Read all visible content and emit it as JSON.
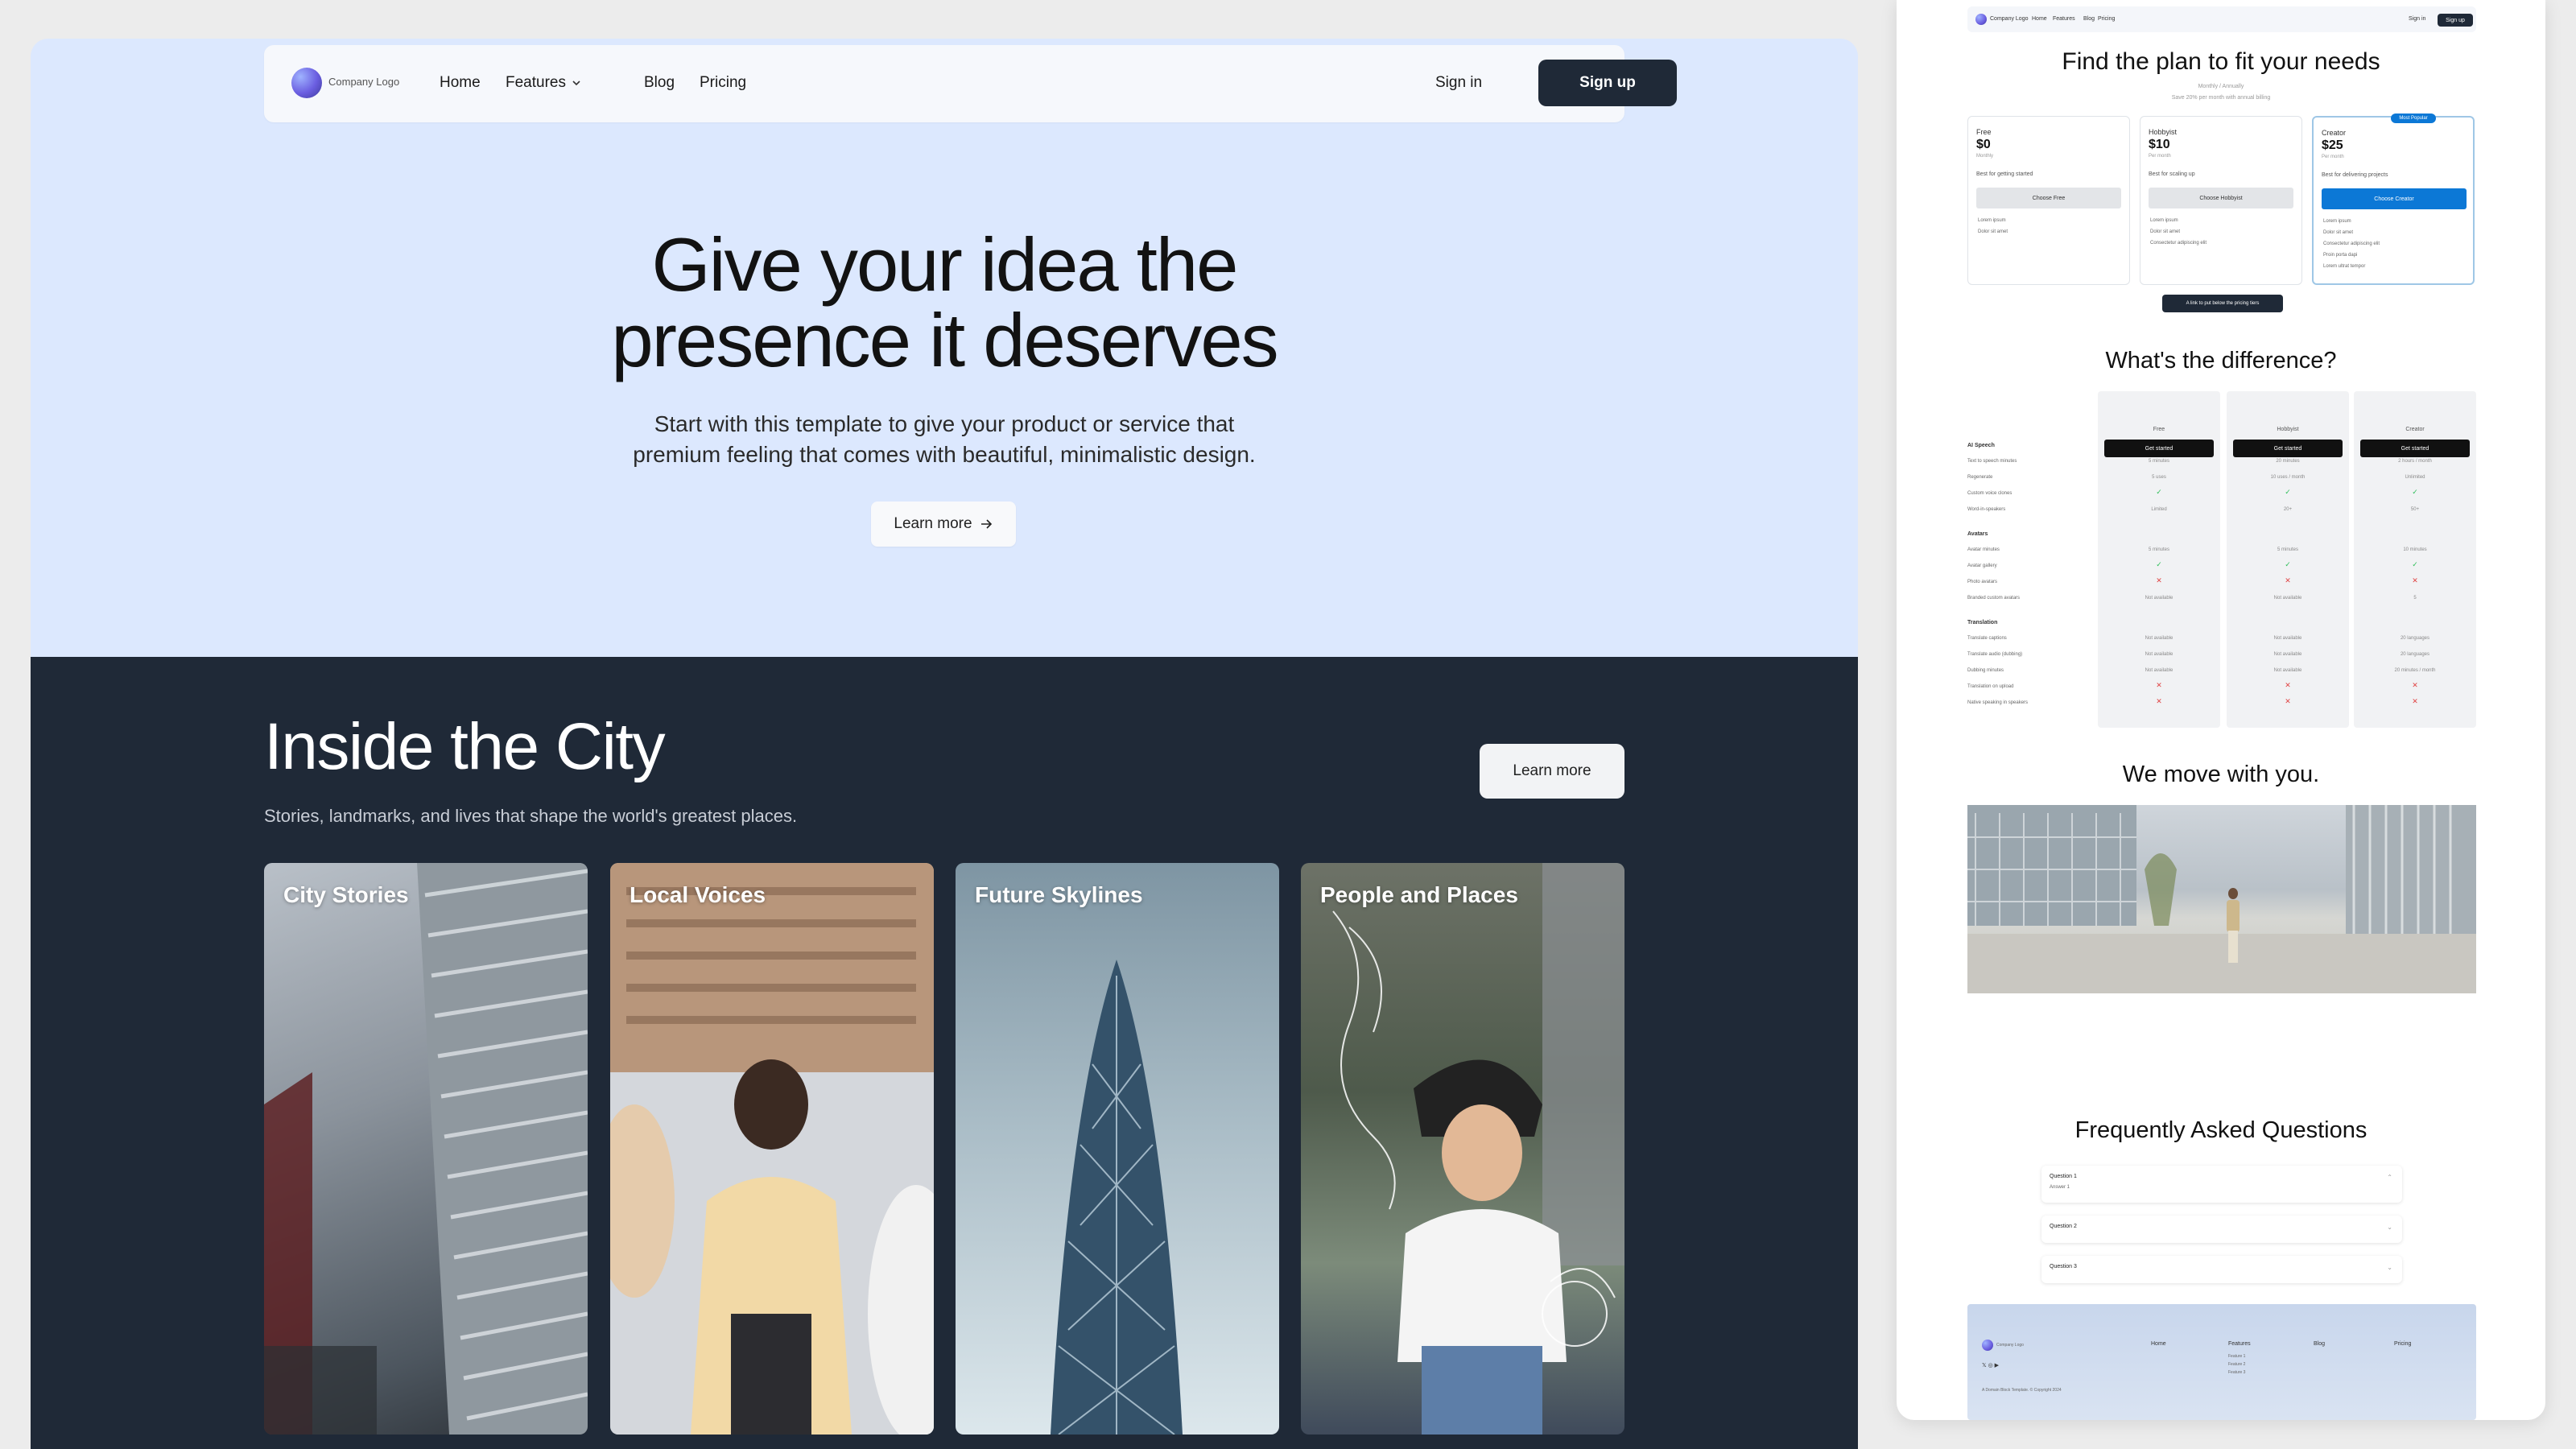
{
  "nav": {
    "logo_text": "Company Logo",
    "links": [
      "Home",
      "Features",
      "Blog",
      "Pricing"
    ],
    "signin": "Sign in",
    "signup": "Sign up"
  },
  "hero": {
    "title_line1": "Give your idea the",
    "title_line2": "presence it deserves",
    "subtitle_line1": "Start with this template to give your product or service that",
    "subtitle_line2": "premium feeling that comes with beautiful, minimalistic design.",
    "button": "Learn more"
  },
  "city": {
    "title": "Inside the City",
    "subtitle": "Stories, landmarks, and lives that shape the world's greatest places.",
    "button": "Learn more",
    "cards": [
      "City Stories",
      "Local Voices",
      "Future Skylines",
      "People and Places"
    ]
  },
  "preview": {
    "nav": {
      "logo_text": "Company Logo",
      "links": [
        "Home",
        "Features",
        "Blog",
        "Pricing"
      ],
      "signin": "Sign in",
      "signup": "Sign up"
    },
    "pricing": {
      "title": "Find the plan to fit your needs",
      "toggle": "Monthly / Annually",
      "subtitle": "Save 20% per month with annual billing",
      "plans": [
        {
          "name": "Free",
          "price": "$0",
          "period": "Monthly",
          "desc": "Best for getting started",
          "button": "Choose Free",
          "features": [
            "Lorem ipsum",
            "Dolor sit amet"
          ]
        },
        {
          "name": "Hobbyist",
          "price": "$10",
          "period": "Per month",
          "desc": "Best for scaling up",
          "button": "Choose Hobbyist",
          "features": [
            "Lorem ipsum",
            "Dolor sit amet",
            "Consectetur adipiscing elit"
          ]
        },
        {
          "name": "Creator",
          "price": "$25",
          "period": "Per month",
          "desc": "Best for delivering projects",
          "button": "Choose Creator",
          "features": [
            "Lorem ipsum",
            "Dolor sit amet",
            "Consectetur adipiscing elit",
            "Proin porta dapi",
            "Lorem ultrat tempor"
          ]
        }
      ],
      "popular_badge": "Most Popular",
      "link_chip": "A link to put below the pricing tiers"
    },
    "difference": {
      "title": "What's the difference?",
      "columns": [
        "Free",
        "Hobbyist",
        "Creator"
      ],
      "col_button": "Get started",
      "sections": [
        {
          "name": "AI Speech",
          "rows": [
            "Text to speech minutes",
            "Regenerate",
            "Custom voice clones",
            "Word-in-speakers"
          ]
        },
        {
          "name": "Avatars",
          "rows": [
            "Avatar minutes",
            "Avatar gallery",
            "Photo avatars",
            "Branded custom avatars"
          ]
        },
        {
          "name": "Translation",
          "rows": [
            "Translate captions",
            "Translate audio (dubbing)",
            "Dubbing minutes",
            "Translation on upload",
            "Native speaking in speakers"
          ]
        }
      ],
      "values": {
        "speech": [
          [
            "5 minutes",
            "20 minutes",
            "2 hours / month"
          ],
          [
            "5 uses",
            "10 uses / month",
            "Unlimited"
          ],
          [
            "check",
            "check",
            "check"
          ],
          [
            "Limited",
            "20+",
            "50+"
          ]
        ],
        "avatars": [
          [
            "5 minutes",
            "5 minutes",
            "10 minutes"
          ],
          [
            "check",
            "check",
            "check"
          ],
          [
            "cross",
            "cross",
            "cross"
          ],
          [
            "Not available",
            "Not available",
            "5"
          ]
        ],
        "translation": [
          [
            "Not available",
            "Not available",
            "20 languages"
          ],
          [
            "Not available",
            "Not available",
            "20 languages"
          ],
          [
            "Not available",
            "Not available",
            "20 minutes / month"
          ],
          [
            "cross",
            "cross",
            "cross"
          ],
          [
            "cross",
            "cross",
            "cross"
          ]
        ]
      }
    },
    "move": {
      "title": "We move with you."
    },
    "faq": {
      "title": "Frequently Asked Questions",
      "items": [
        {
          "q": "Question 1",
          "a": "Answer 1"
        },
        {
          "q": "Question 2",
          "a": ""
        },
        {
          "q": "Question 3",
          "a": ""
        }
      ]
    },
    "footer": {
      "logo_text": "Company Logo",
      "columns": [
        "Home",
        "Features",
        "Blog",
        "Pricing"
      ],
      "feature_links": [
        "Feature 1",
        "Feature 2",
        "Feature 3"
      ],
      "copyright": "A Domain Block Template. © Copyright 2024"
    }
  }
}
